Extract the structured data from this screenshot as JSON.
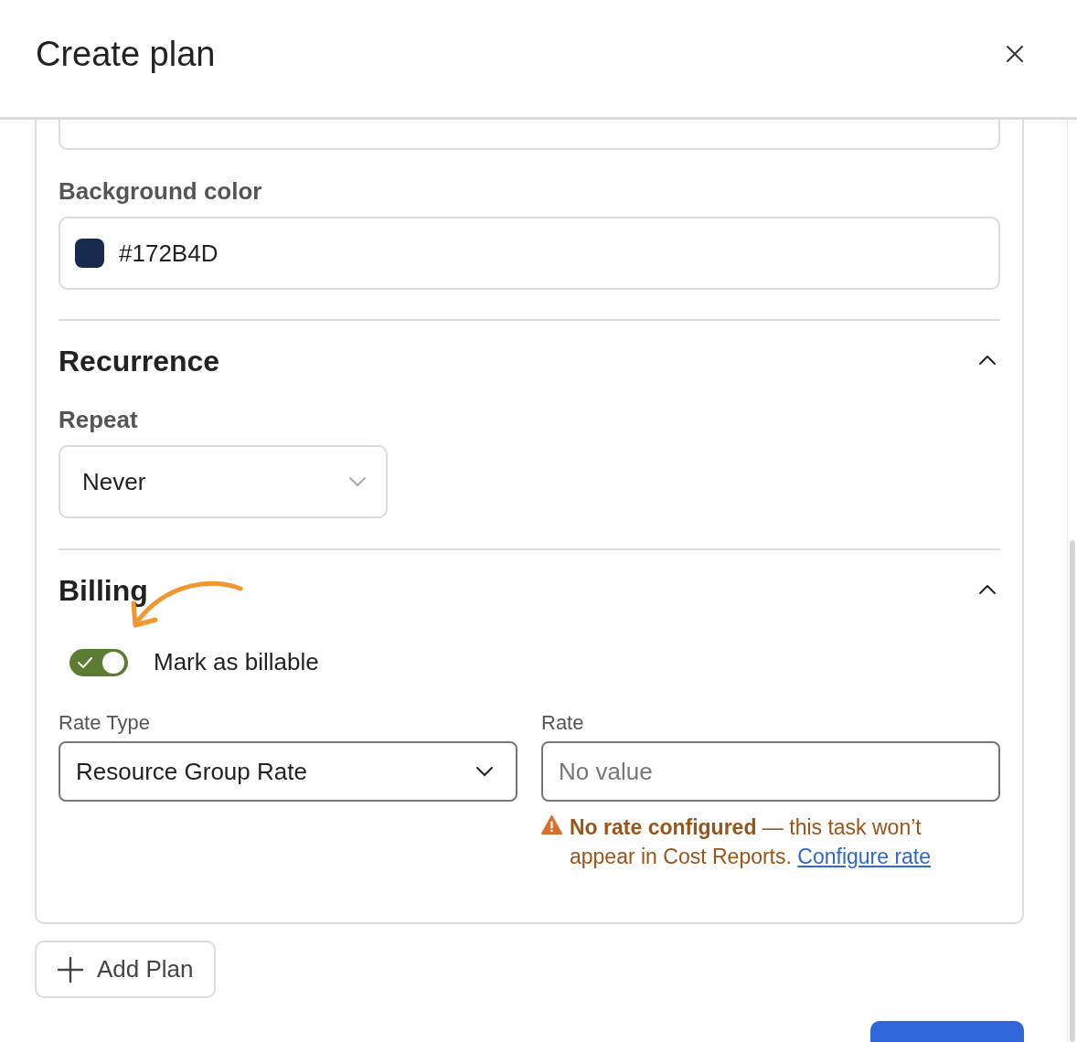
{
  "dialog": {
    "title": "Create plan"
  },
  "background_color": {
    "label": "Background color",
    "value": "#172B4D"
  },
  "recurrence": {
    "title": "Recurrence",
    "expanded": true,
    "repeat": {
      "label": "Repeat",
      "value": "Never"
    }
  },
  "billing": {
    "title": "Billing",
    "expanded": true,
    "billable": {
      "label": "Mark as billable",
      "on": true
    },
    "rate_type": {
      "label": "Rate Type",
      "value": "Resource Group Rate"
    },
    "rate": {
      "label": "Rate",
      "placeholder": "No value"
    },
    "warning": {
      "text": "**No rate configured** — this task won’t appear in Cost Reports.",
      "link": "Configure rate"
    }
  },
  "add_plan": {
    "label": "Add Plan"
  }
}
